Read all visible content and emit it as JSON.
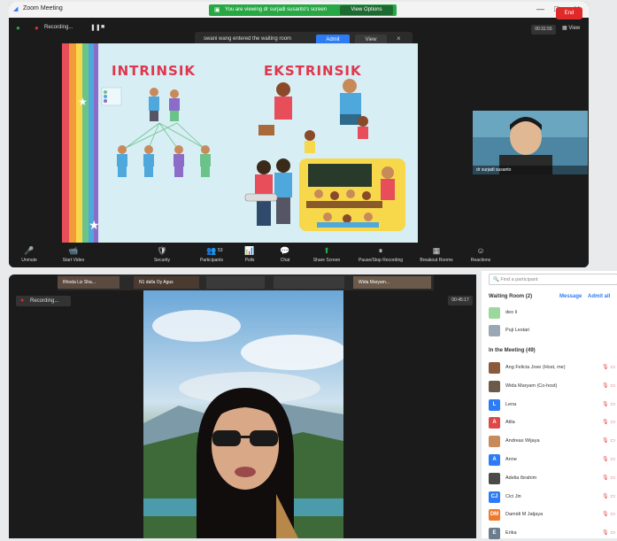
{
  "top_window": {
    "app_title": "Zoom Meeting",
    "share_banner": "You are viewing dr surjadi susanto's screen",
    "view_options": "View Options",
    "recording_label": "Recording...",
    "notification": {
      "text": "swani wang entered the waiting room",
      "admit": "Admit",
      "view": "View"
    },
    "timer": "00:31:55",
    "view_label": "View",
    "slide": {
      "left_heading": "INTRINSIK",
      "right_heading": "EKSTRINSIK"
    },
    "speaker_name": "dr surjadi susanto",
    "toolbar": [
      {
        "icon": "mic-muted-icon",
        "glyph": "🎤",
        "label": "Unmute"
      },
      {
        "icon": "video-icon",
        "glyph": "📹",
        "label": "Start Video"
      },
      {
        "icon": "shield-icon",
        "glyph": "🛡",
        "label": "Security"
      },
      {
        "icon": "participants-icon",
        "glyph": "👥",
        "label": "Participants",
        "count": "53"
      },
      {
        "icon": "polls-icon",
        "glyph": "📊",
        "label": "Polls"
      },
      {
        "icon": "chat-icon",
        "glyph": "💬",
        "label": "Chat"
      },
      {
        "icon": "share-screen-icon",
        "glyph": "⬆",
        "label": "Share Screen"
      },
      {
        "icon": "record-icon",
        "glyph": "⏸",
        "label": "Pause/Stop Recording"
      },
      {
        "icon": "breakout-icon",
        "glyph": "▦",
        "label": "Breakout Rooms"
      },
      {
        "icon": "reactions-icon",
        "glyph": "☺",
        "label": "Reactions"
      }
    ],
    "end_label": "End",
    "colors": {
      "accent": "#2d7cf6",
      "green": "#27a844",
      "end": "#e02a2a",
      "heading": "#e0364c"
    }
  },
  "bottom_window": {
    "thumb_labels": [
      "Rhoda Liz Sha...",
      "N1 dalla Oy Agus",
      "",
      "",
      "Wida Maryam..."
    ],
    "recording_label": "Recording...",
    "timer": "00:45:17"
  },
  "participants_panel": {
    "search_placeholder": "Find a participant",
    "waiting_room_title": "Waiting Room (2)",
    "message_link": "Message",
    "admit_all_link": "Admit all",
    "waiting": [
      {
        "initial": "",
        "name": "deo li",
        "color": "#9ed79e"
      },
      {
        "initial": "",
        "name": "Puji Lestari",
        "color": "#9aa7b5"
      }
    ],
    "in_meeting_title": "In the Meeting (49)",
    "members": [
      {
        "initial": "",
        "name": "Ang Felicia Jose (Host, me)",
        "color": "#8a5a3c"
      },
      {
        "initial": "",
        "name": "Wida Maryam (Co-host)",
        "color": "#6b5a48"
      },
      {
        "initial": "L",
        "name": "Lena",
        "color": "#2d7cf6"
      },
      {
        "initial": "A",
        "name": "Atila",
        "color": "#e04848"
      },
      {
        "initial": "",
        "name": "Andreas Wijaya",
        "color": "#c98a5a"
      },
      {
        "initial": "A",
        "name": "Anne",
        "color": "#2d7cf6"
      },
      {
        "initial": "",
        "name": "Adelia Ibrahim",
        "color": "#4a4a4a"
      },
      {
        "initial": "CJ",
        "name": "Cici Jin",
        "color": "#2d7cf6"
      },
      {
        "initial": "DM",
        "name": "Damidi M Jatjaya",
        "color": "#f07a2a"
      },
      {
        "initial": "E",
        "name": "Erika",
        "color": "#6b7c8c"
      }
    ]
  }
}
